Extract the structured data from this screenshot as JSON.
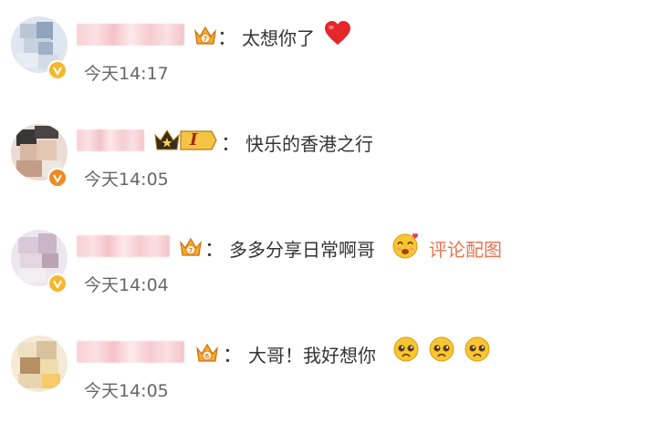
{
  "comments": [
    {
      "text": "太想你了",
      "time": "今天14:17"
    },
    {
      "text": "快乐的香港之行",
      "time": "今天14:05",
      "vip_level": "I"
    },
    {
      "text": "多多分享日常啊哥",
      "time": "今天14:04",
      "link": "评论配图"
    },
    {
      "text": "大哥！我好想你",
      "time": "今天14:05"
    }
  ],
  "separator": "：",
  "colors": {
    "link": "#eb7350",
    "verified_gold": "#f5b82c",
    "verified_orange": "#f08a24",
    "heart": "#e5262b"
  }
}
